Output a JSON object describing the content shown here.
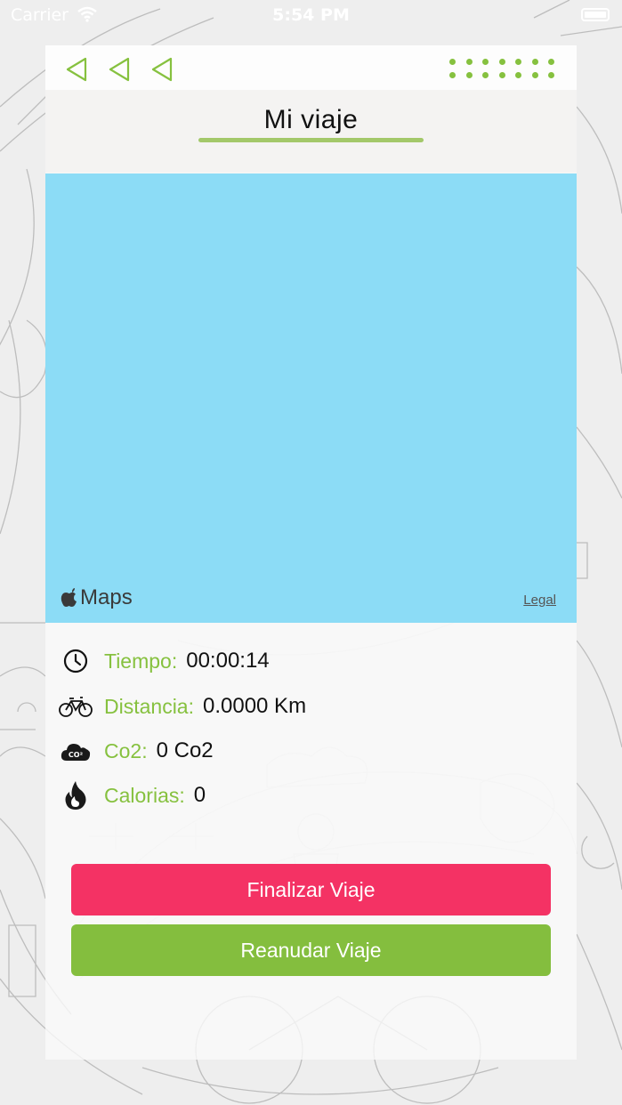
{
  "status_bar": {
    "carrier": "Carrier",
    "time": "5:54 PM"
  },
  "header": {
    "title": "Mi viaje"
  },
  "map": {
    "attribution": "Maps",
    "legal": "Legal"
  },
  "stats": {
    "time": {
      "label": "Tiempo:",
      "value": "00:00:14",
      "icon": "clock-icon"
    },
    "distance": {
      "label": "Distancia:",
      "value": "0.0000 Km",
      "icon": "bike-icon"
    },
    "co2": {
      "label": "Co2:",
      "value": "0 Co2",
      "icon": "co2-cloud-icon"
    },
    "calories": {
      "label": "Calorias:",
      "value": "0",
      "icon": "flame-icon"
    }
  },
  "actions": {
    "end_label": "Finalizar Viaje",
    "resume_label": "Reanudar Viaje"
  },
  "colors": {
    "accent_green": "#86c13f",
    "end_red": "#f43264",
    "map_blue": "#8cdcf6"
  }
}
